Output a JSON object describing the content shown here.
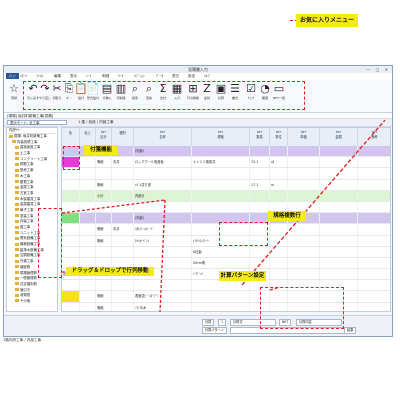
{
  "window": {
    "title": "見積書入力",
    "controls": "— □ ✕"
  },
  "menu": {
    "items": [
      "ﾒﾆｭｰ",
      "ｽﾀｰﾄ",
      "ﾌｧｲﾙ",
      "編集",
      "表示",
      "ｼｰﾄ",
      "明細",
      "ﾂｰﾙ",
      "ｵﾌﾟｼｮﾝ",
      "ﾃﾞｰﾀ",
      "書式",
      "設定",
      "ﾍﾙﾌﾟ"
    ]
  },
  "ribbon": {
    "buttons": [
      {
        "icon": "star-icon",
        "glyph": "☆",
        "label": "登録"
      },
      {
        "icon": "undo-icon",
        "glyph": "↶",
        "label": "元に戻す"
      },
      {
        "icon": "redo-icon",
        "glyph": "↷",
        "label": "やり直し"
      },
      {
        "icon": "cut-icon",
        "glyph": "✂",
        "label": "切取り"
      },
      {
        "icon": "copy-icon",
        "glyph": "⎘",
        "label": "ｺﾋﾟｰ"
      },
      {
        "icon": "paste-icon",
        "glyph": "📋",
        "label": "貼付"
      },
      {
        "icon": "paste-special-icon",
        "glyph": "📄",
        "label": "形式貼付"
      },
      {
        "icon": "row-insert-icon",
        "glyph": "▤",
        "label": "行挿入"
      },
      {
        "icon": "row-delete-icon",
        "glyph": "▥",
        "label": "行削除"
      },
      {
        "icon": "search-icon",
        "glyph": "⌕",
        "label": "検索"
      },
      {
        "icon": "replace-icon",
        "glyph": "⌕",
        "label": "置換"
      },
      {
        "icon": "sum-icon",
        "glyph": "Σ",
        "label": "合計"
      },
      {
        "icon": "layout-icon",
        "glyph": "▦",
        "label": "入力"
      },
      {
        "icon": "table-icon",
        "glyph": "⊞",
        "label": "行の移動"
      },
      {
        "icon": "z-icon",
        "glyph": "Z",
        "label": "並替"
      },
      {
        "icon": "doc-icon",
        "glyph": "▣",
        "label": "計算"
      },
      {
        "icon": "form-icon",
        "glyph": "☰",
        "label": "書式"
      },
      {
        "icon": "check-icon",
        "glyph": "☑",
        "label": "ﾁｪｯｸ"
      },
      {
        "icon": "clock-icon",
        "glyph": "◔",
        "label": "履歴"
      },
      {
        "icon": "net-icon",
        "glyph": "▭",
        "label": "NET一括"
      }
    ]
  },
  "callouts": {
    "favorites": "お気に入りメニュー",
    "sticky": "付箋機能",
    "drag_drop": "ドラッグ＆ドロップで行列移動",
    "spec_multi": "規格複数行",
    "calc_pattern": "計算パターン設定"
  },
  "address": "[現場] 坂井町新築工事[見積]",
  "pathbar": {
    "selector": "表示モード: 全工事",
    "crumb": "1 建 / 仮設 / 内部工事"
  },
  "tree": {
    "header": "内訳ﾂﾘｰ",
    "items": [
      "現場: 坂井町新築工事",
      "内装改修工事",
      "直接仮設工事",
      "土工事",
      "コンクリート工事",
      "鉄筋工事",
      "型枠工事",
      "木工事",
      "屋根工事",
      "金属工事",
      "左官工事",
      "木製建具工事",
      "金属建具工事",
      "硝子工事",
      "塗装工事",
      "内装工事",
      "雑工事",
      "ユニット工事",
      "電気設備工事",
      "機械設備工事",
      "給排水設備工事",
      "空調設備工事",
      "外構工事",
      "諸経費",
      "現場管理費",
      "一般管理費",
      "法定福利費",
      "値引き",
      "消費税",
      "その他"
    ]
  },
  "grid": {
    "headers": [
      {
        "label": "色",
        "sub": ""
      },
      {
        "label": "色上",
        "sub": ""
      },
      {
        "label": "区分",
        "sub": "NET"
      },
      {
        "label": "種別",
        "sub": ""
      },
      {
        "label": "名称",
        "sub": "NET"
      },
      {
        "label": "規格",
        "sub": "NET"
      },
      {
        "label": "数量",
        "sub": "NET"
      },
      {
        "label": "単位",
        "sub": "NET"
      },
      {
        "label": "単価",
        "sub": "NET"
      },
      {
        "label": "金額",
        "sub": "NET"
      },
      {
        "label": "備考",
        "sub": "NET"
      }
    ],
    "rows": [
      {
        "style": "purple",
        "swatch": "",
        "cells": [
          "",
          "",
          "",
          "",
          "(内部)",
          "",
          "",
          "",
          "",
          "",
          ""
        ]
      },
      {
        "style": "",
        "swatch": "#e83ad8",
        "cells": [
          "",
          "",
          "明細",
          "天井",
          "ロックウール吸音板",
          "ｔ＝１２捨張共",
          "13.1",
          "㎡",
          "",
          "",
          ""
        ]
      },
      {
        "style": "",
        "swatch": "",
        "cells": [
          "",
          "",
          "",
          "",
          "",
          "",
          "",
          "",
          "",
          "",
          ""
        ]
      },
      {
        "style": "",
        "swatch": "",
        "cells": [
          "",
          "",
          "明細",
          "",
          "ｵｼﾞﾙ塗り張",
          "",
          "17.1",
          "m",
          "",
          "",
          ""
        ]
      },
      {
        "style": "green",
        "swatch": "",
        "cells": [
          "",
          "",
          "小計",
          "",
          "内部計",
          "",
          "",
          "",
          "",
          "",
          ""
        ]
      },
      {
        "style": "",
        "swatch": "",
        "cells": [
          "",
          "",
          "",
          "",
          "",
          "",
          "",
          "",
          "",
          "",
          ""
        ]
      },
      {
        "style": "purple",
        "swatch": "#7ee07e",
        "cells": [
          "",
          "",
          "",
          "",
          "(内部)",
          "",
          "",
          "",
          "",
          "",
          ""
        ]
      },
      {
        "style": "",
        "swatch": "",
        "cells": [
          "",
          "",
          "明細",
          "天井",
          "ｽﾀﾙﾌﾚｰﾑﾎﾞｰﾄﾞ",
          "",
          "",
          "",
          "",
          "",
          ""
        ]
      },
      {
        "style": "",
        "swatch": "",
        "cells": [
          "",
          "",
          "明細",
          "",
          "ﾀｲﾙｶｰﾍﾟｯﾄ",
          "ｲﾝﾀｰﾛｯｸｼｰﾄ",
          "",
          "",
          "",
          "",
          ""
        ]
      },
      {
        "style": "",
        "swatch": "",
        "cells": [
          "",
          "",
          "",
          "",
          "",
          "A社製",
          "",
          "",
          "",
          "",
          ""
        ]
      },
      {
        "style": "",
        "swatch": "",
        "cells": [
          "",
          "",
          "",
          "",
          "",
          "50cm角",
          "",
          "",
          "",
          "",
          ""
        ]
      },
      {
        "style": "",
        "swatch": "",
        "cells": [
          "区切線",
          "",
          "明細",
          "天井",
          "ゴム系ﾀｲﾙ",
          "ｿｰﾀﾞﾝﾊﾟ",
          "",
          "",
          "",
          "",
          ""
        ]
      },
      {
        "style": "",
        "swatch": "",
        "cells": [
          "",
          "",
          "",
          "",
          "",
          "",
          "",
          "",
          "",
          "",
          ""
        ]
      },
      {
        "style": "",
        "swatch": "#f7e21a",
        "cells": [
          "",
          "",
          "明細",
          "",
          "表面塗ﾋﾞｰﾑﾀﾞﾃﾞﾄ",
          "",
          "",
          "",
          "",
          "",
          ""
        ]
      },
      {
        "style": "",
        "swatch": "",
        "cells": [
          "",
          "",
          "明細",
          "",
          "ｿﾌﾄ巾木",
          "",
          "",
          "",
          "",
          "",
          ""
        ]
      },
      {
        "style": "",
        "swatch": "",
        "cells": [
          "",
          "",
          "明細",
          "",
          "ｿﾌﾄ巾木",
          "",
          "",
          "",
          "",
          "",
          ""
        ]
      }
    ]
  },
  "bottom": {
    "labels": [
      "計算",
      "1",
      "計算式",
      "NET",
      "計算内容",
      "1",
      "2",
      "3",
      "4",
      "5",
      "6"
    ],
    "formula_label": "計算パターン",
    "result_label": "結果"
  },
  "status": "1階内訳工事 / 内部工事"
}
